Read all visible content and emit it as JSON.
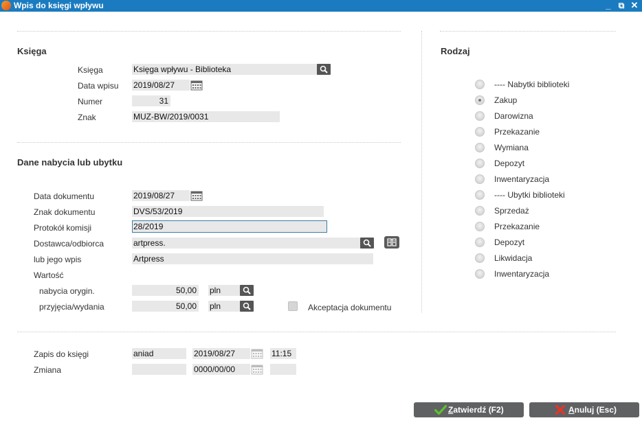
{
  "window": {
    "title": "Wpis do księgi wpływu",
    "minimize": "_",
    "restore": "⧉",
    "close": "✕"
  },
  "ksiega": {
    "section_title": "Księga",
    "ksiega_label": "Księga",
    "ksiega_value": "Księga wpływu - Biblioteka",
    "data_wpisu_label": "Data wpisu",
    "data_wpisu_value": "2019/08/27",
    "numer_label": "Numer",
    "numer_value": "31",
    "znak_label": "Znak",
    "znak_value": "MUZ-BW/2019/0031"
  },
  "dane": {
    "section_title": "Dane nabycia lub ubytku",
    "data_dokumentu_label": "Data dokumentu",
    "data_dokumentu_value": "2019/08/27",
    "znak_dokumentu_label": "Znak dokumentu",
    "znak_dokumentu_value": "DVS/53/2019",
    "protokol_label": "Protokół komisji",
    "protokol_value": "28/2019",
    "dostawca_label": "Dostawca/odbiorca",
    "dostawca_value": "artpress.",
    "wpis_label": "lub jego wpis",
    "wpis_value": "Artpress",
    "wartosc_label": "Wartość",
    "nabycia_label": "nabycia orygin.",
    "nabycia_value": "50,00",
    "nabycia_currency": "pln",
    "przyjecia_label": "przyjęcia/wydania",
    "przyjecia_value": "50,00",
    "przyjecia_currency": "pln",
    "akceptacja_label": "Akceptacja dokumentu",
    "akceptacja_checked": false
  },
  "rodzaj": {
    "section_title": "Rodzaj",
    "selected_index": 1,
    "options": [
      "---- Nabytki biblioteki",
      "Zakup",
      "Darowizna",
      "Przekazanie",
      "Wymiana",
      "Depozyt",
      "Inwentaryzacja",
      "---- Ubytki biblioteki",
      "Sprzedaż",
      "Przekazanie",
      "Depozyt",
      "Likwidacja",
      "Inwentaryzacja"
    ]
  },
  "zapis": {
    "zapis_label": "Zapis do księgi",
    "zapis_user": "aniad",
    "zapis_date": "2019/08/27",
    "zapis_time": "11:15",
    "zmiana_label": "Zmiana",
    "zmiana_user": "",
    "zmiana_date": "0000/00/00",
    "zmiana_time": ""
  },
  "buttons": {
    "confirm_key": "Z",
    "confirm_rest": "atwierdź (F2)",
    "cancel_key": "A",
    "cancel_rest": "nuluj (Esc)"
  },
  "colors": {
    "titlebar": "#1b7bc0",
    "confirm_icon": "#5cc12e",
    "cancel_icon": "#e2362a"
  }
}
